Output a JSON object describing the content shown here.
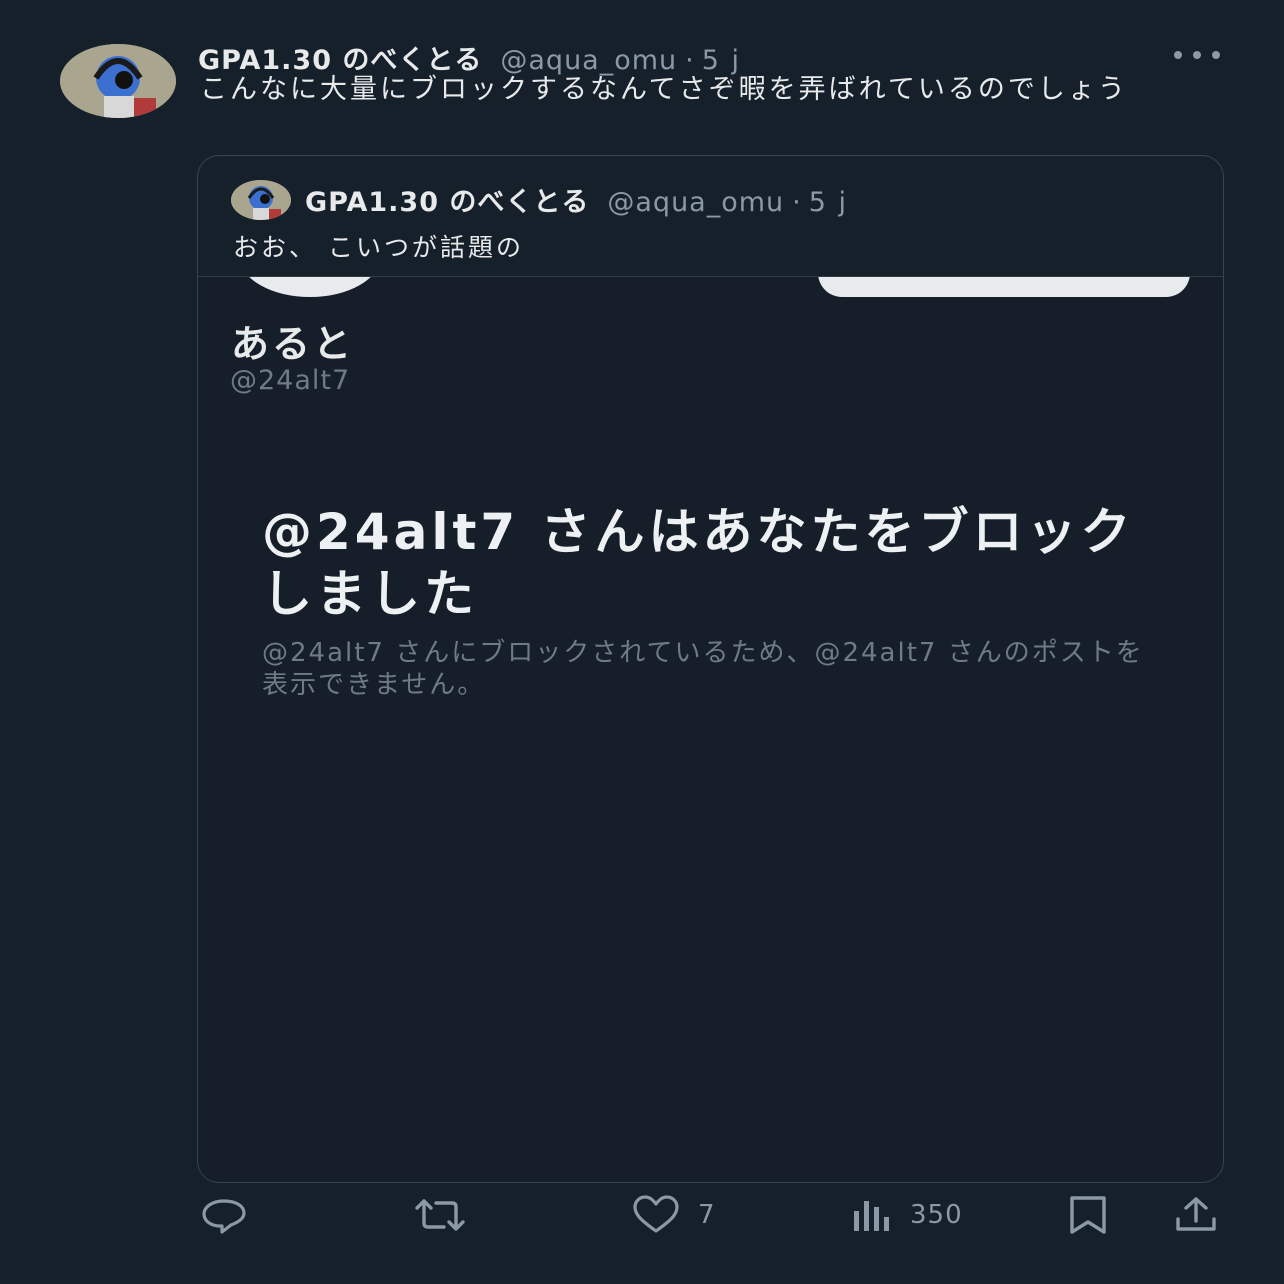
{
  "tweet": {
    "display_name": "GPA1.30 のべくとる",
    "handle": "@aqua_omu",
    "separator": "·",
    "time": "5 j",
    "text": "こんなに大量にブロックするなんてさぞ暇を弄ばれているのでしょう"
  },
  "quote": {
    "display_name": "GPA1.30 のべくとる",
    "handle": "@aqua_omu",
    "separator": "·",
    "time": "5 j",
    "text": "おお、 こいつが話題の"
  },
  "screenshot": {
    "profile_name": "あると",
    "profile_handle": "@24alt7",
    "blocked_title": "@24alt7 さんはあなたをブロックしました",
    "blocked_description": "@24alt7 さんにブロックされているため、@24alt7 さんのポストを表示できません。"
  },
  "actions": {
    "reply": {
      "icon": "reply-icon",
      "count": ""
    },
    "repost": {
      "icon": "repost-icon",
      "count": ""
    },
    "like": {
      "icon": "heart-icon",
      "count": "7"
    },
    "views": {
      "icon": "views-icon",
      "count": "350"
    },
    "bookmark": {
      "icon": "bookmark-icon"
    },
    "share": {
      "icon": "share-icon"
    }
  },
  "colors": {
    "background": "#15202b",
    "primary_text": "#e7e9ea",
    "secondary_text": "#8b98a5",
    "border": "#38444d"
  }
}
